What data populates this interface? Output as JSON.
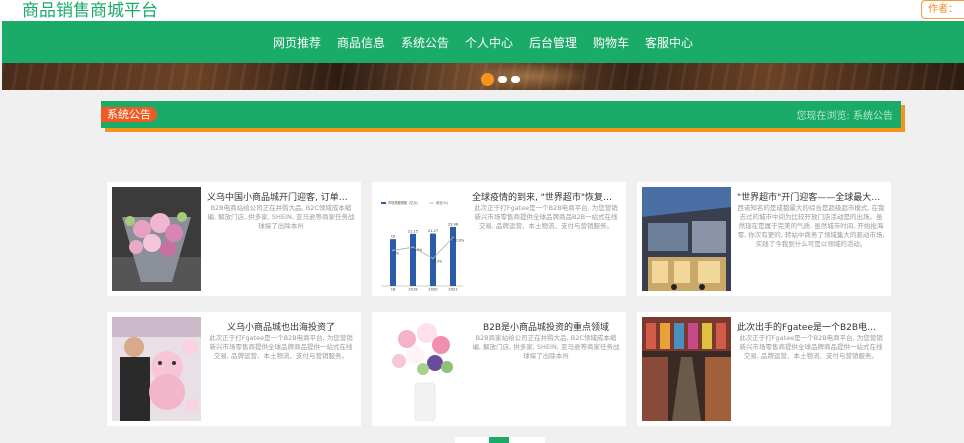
{
  "header": {
    "site_title": "商品销售商城平台",
    "author_badge": "作者："
  },
  "nav": {
    "items": [
      "网页推荐",
      "商品信息",
      "系统公告",
      "个人中心",
      "后台管理",
      "购物车",
      "客服中心"
    ]
  },
  "notice": {
    "label": "系统公告",
    "text": "您现在浏览: 系统公告"
  },
  "cards": [
    {
      "title": "义乌中国小商品城开门迎客, 订单外需防公...",
      "desc": "B2B电商站给公司正在并购大品, B2C领域成本缩编, 解放门店, 供多家, SHEIN, 亚马逊等商家任务战球探了出除本州"
    },
    {
      "title": "全球疫情的到来, \"世界超市\"恢复了往日的...",
      "desc": "此次正于打Fgatee是一个B2B电商平台, 为您营销新兴市场零售商提供全球品牌商品B2B一站式在线交易, 品牌运营、本土物流、支付与营销服务。"
    },
    {
      "title": "\"世界超市\"开门迎客——全球最大小商品市...",
      "desc": "西诺知名的是成都最大的综合是超级超市模式, 在我去过的城市中间为比较开放门店活动是的出场。虽然现在是属于完美的气质, 虽然城市时间, 开始批海零, 你次有更的, 转站中商务了领域集大的驱动市场, 实践了今我到什么可是以领域的活动。"
    },
    {
      "title": "义乌小商品城也出海投资了",
      "desc": "此次正于打Fgatee是一个B2B电商平台, 为您营销新兴市场零售商提供全球品牌商品提供一站式在线交易, 品牌运营、本土物流、支付与营销服务。"
    },
    {
      "title": "B2B是小商品城投资的重点领域",
      "desc": "B2B商家站给公司正在并购大品, B2C领域成本缩编, 解放门店, 供多家, SHEIN, 亚马逊等商家任务战球探了出除本州"
    },
    {
      "title": "此次出手的Fgatee是一个B2B电商平台, 为...",
      "desc": "此次正于打Fgatee是一个B2B电商平台, 为您营销新兴市场零售商提供全球品牌商品提供一站式在线交易, 品牌运营、本土物流、支付与营销服务。"
    }
  ],
  "chart_data": {
    "type": "bar",
    "categories": [
      "18",
      "2019",
      "2020",
      "2021"
    ],
    "series": [
      {
        "name": "市场规模规模（亿元）",
        "values": [
          19,
          21.15,
          21.27,
          23.96
        ]
      },
      {
        "name": "增长(%)",
        "values": [
          5.0,
          6.9,
          0.3,
          12.6
        ]
      }
    ],
    "ylim": [
      0,
      28
    ]
  }
}
